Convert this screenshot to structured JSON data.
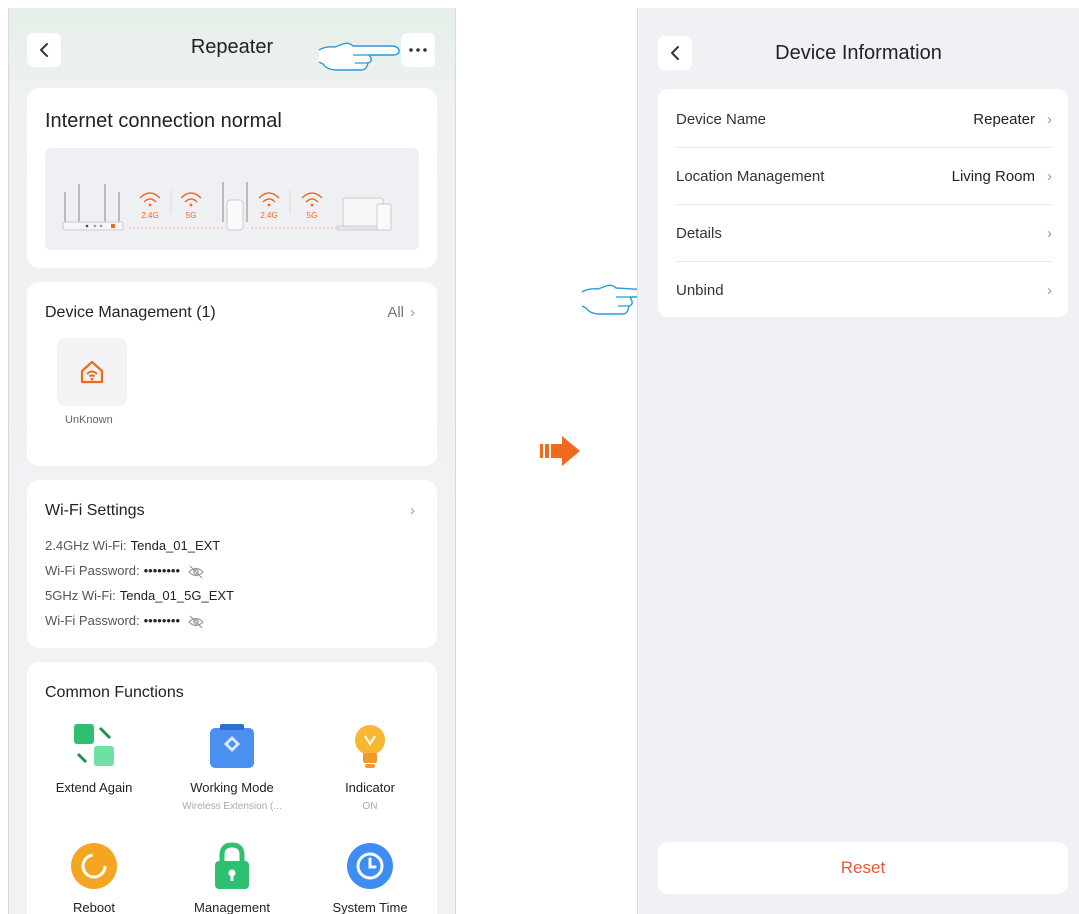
{
  "left_screen": {
    "header": {
      "title": "Repeater",
      "back_icon": "chevron-left-icon",
      "more_icon": "more-horizontal-icon"
    },
    "status": {
      "title": "Internet connection normal",
      "band_labels": [
        "2.4G",
        "5G",
        "2.4G",
        "5G"
      ]
    },
    "device_management": {
      "title": "Device Management (1)",
      "all_label": "All",
      "devices": [
        {
          "name": "UnKnown",
          "icon": "home-wifi-icon"
        }
      ]
    },
    "wifi_settings": {
      "title": "Wi-Fi Settings",
      "rows": [
        {
          "label": "2.4GHz Wi-Fi:",
          "value": "Tenda_01_EXT"
        },
        {
          "label": "Wi-Fi Password:",
          "value": "••••••••"
        },
        {
          "label": "5GHz Wi-Fi:",
          "value": "Tenda_01_5G_EXT"
        },
        {
          "label": "Wi-Fi Password:",
          "value": "••••••••"
        }
      ]
    },
    "common_functions": {
      "title": "Common Functions",
      "items": [
        {
          "label": "Extend Again",
          "sub": "",
          "icon": "extend-again-icon"
        },
        {
          "label": "Working Mode",
          "sub": "Wireless Extension (...",
          "icon": "working-mode-icon"
        },
        {
          "label": "Indicator",
          "sub": "ON",
          "icon": "lightbulb-icon"
        },
        {
          "label": "Reboot",
          "sub": "",
          "icon": "reboot-icon"
        },
        {
          "label": "Management",
          "sub": "",
          "icon": "lock-icon"
        },
        {
          "label": "System Time",
          "sub": "",
          "icon": "clock-icon"
        }
      ]
    }
  },
  "right_screen": {
    "header": {
      "title": "Device Information",
      "back_icon": "chevron-left-icon"
    },
    "rows": [
      {
        "label": "Device Name",
        "value": "Repeater"
      },
      {
        "label": "Location Management",
        "value": "Living Room"
      },
      {
        "label": "Details",
        "value": ""
      },
      {
        "label": "Unbind",
        "value": ""
      }
    ],
    "reset_label": "Reset"
  },
  "colors": {
    "accent_orange": "#F06A1E",
    "reset_red": "#E8563B",
    "hand_pointer_blue": "#2A9AD6",
    "page_bg": "#EFF1F4"
  }
}
